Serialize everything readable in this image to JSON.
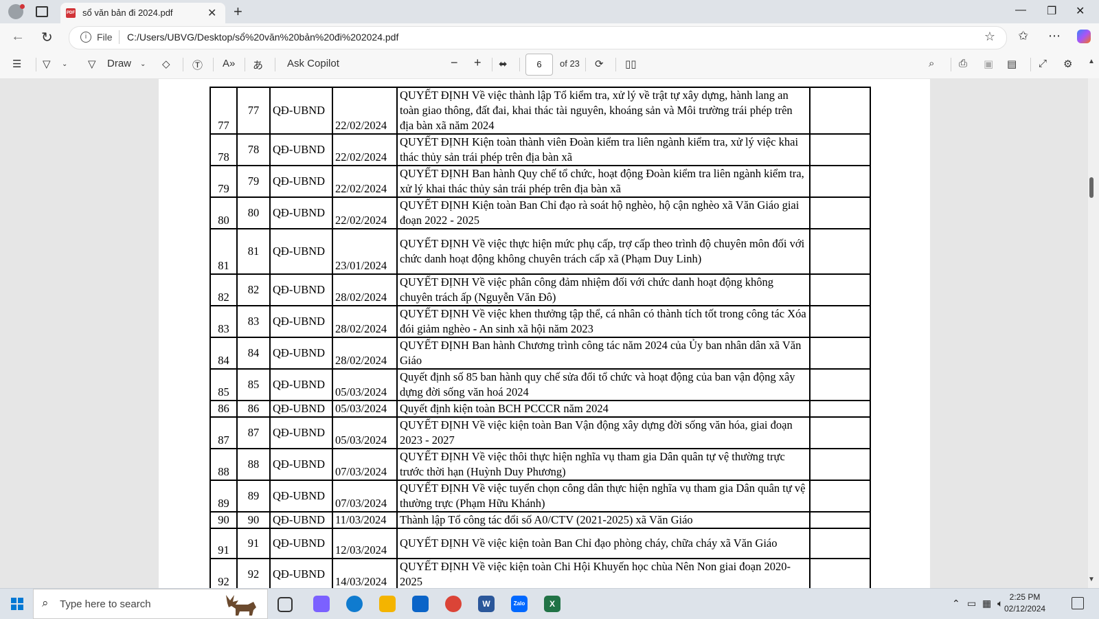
{
  "browser": {
    "tab_title": "sổ văn bản đi 2024.pdf",
    "tab_close": "✕",
    "new_tab": "+",
    "url_prefix": "File",
    "url": "C:/Users/UBVG/Desktop/sổ%20văn%20bản%20đi%202024.pdf",
    "window_controls": [
      "—",
      "❐",
      "✕"
    ]
  },
  "pdf_toolbar": {
    "draw_label": "Draw",
    "ask_copilot_label": "Ask Copilot",
    "page_number": "6",
    "page_total": "of 23",
    "zoom_out": "−",
    "zoom_in": "+"
  },
  "table": {
    "rows": [
      {
        "stt": "77",
        "num": "77",
        "type": "QĐ-UBND",
        "date": "22/02/2024",
        "content": " QUYẾT ĐỊNH Về việc thành lập Tổ kiểm tra, xử lý về trật tự xây dựng, hành lang an toàn giao thông, đất đai, khai thác tài nguyên, khoáng sản và Môi trường trái phép trên địa bàn xã năm 2024"
      },
      {
        "stt": "78",
        "num": "78",
        "type": "QĐ-UBND",
        "date": "22/02/2024",
        "content": "QUYẾT ĐỊNH Kiện toàn thành viên Đoàn kiểm tra liên ngành kiểm tra, xử lý việc khai thác thủy sản trái phép trên địa bàn xã"
      },
      {
        "stt": "79",
        "num": "79",
        "type": "QĐ-UBND",
        "date": "22/02/2024",
        "content": "QUYẾT ĐỊNH Ban hành Quy chế tổ chức, hoạt động Đoàn kiểm tra liên ngành kiểm tra, xử lý khai thác thủy sản trái phép trên địa bàn xã"
      },
      {
        "stt": "80",
        "num": "80",
        "type": "QĐ-UBND",
        "date": "22/02/2024",
        "content": "QUYẾT ĐỊNH Kiện toàn Ban Chỉ đạo rà soát hộ nghèo, hộ cận nghèo xã Văn Giáo giai đoạn 2022 - 2025"
      },
      {
        "stt": "81",
        "num": "81",
        "type": "QĐ-UBND",
        "date": "23/01/2024",
        "content": "QUYẾT ĐỊNH Về việc thực hiện mức phụ cấp, trợ cấp theo trình độ chuyên môn đối với chức danh hoạt động không chuyên trách cấp xã (Phạm Duy Linh)"
      },
      {
        "stt": "82",
        "num": "82",
        "type": "QĐ-UBND",
        "date": "28/02/2024",
        "content": " QUYẾT ĐỊNH Về việc phân công đảm nhiệm đối với chức danh hoạt động không chuyên trách ấp (Nguyễn Văn Đô)"
      },
      {
        "stt": "83",
        "num": "83",
        "type": "QĐ-UBND",
        "date": "28/02/2024",
        "content": "QUYẾT ĐỊNH Về việc khen thưởng tập thể, cá nhân có thành tích tốt trong công tác Xóa đói giảm nghèo - An sinh xã hội năm 2023"
      },
      {
        "stt": "84",
        "num": "84",
        "type": "QĐ-UBND",
        "date": "28/02/2024",
        "content": "QUYẾT ĐỊNH Ban hành Chương trình công tác năm 2024 của Ủy ban nhân dân xã Văn Giáo"
      },
      {
        "stt": "85",
        "num": "85",
        "type": "QĐ-UBND",
        "date": "05/03/2024",
        "content": "Quyết định số 85 ban hành quy chế sửa đổi tổ chức và hoạt động của ban vận động xây dựng đời sống văn hoá 2024"
      },
      {
        "stt": "86",
        "num": "86",
        "type": "QĐ-UBND",
        "date": "05/03/2024",
        "content": "Quyết định kiện toàn BCH PCCCR năm 2024"
      },
      {
        "stt": "87",
        "num": "87",
        "type": "QĐ-UBND",
        "date": "05/03/2024",
        "content": "QUYẾT ĐỊNH Về việc kiện toàn Ban Vận động xây dựng đời sống văn hóa, giai đoạn 2023 - 2027"
      },
      {
        "stt": "88",
        "num": "88",
        "type": "QĐ-UBND",
        "date": "07/03/2024",
        "content": "QUYẾT ĐỊNH Về việc thôi thực hiện nghĩa vụ tham gia Dân quân tự vệ thường trực trước thời hạn (Huỳnh Duy Phương)"
      },
      {
        "stt": "89",
        "num": "89",
        "type": "QĐ-UBND",
        "date": "07/03/2024",
        "content": "QUYẾT ĐỊNH Về việc tuyển chọn công dân thực hiện nghĩa vụ tham gia Dân quân tự vệ thường trực (Phạm Hữu Khánh)"
      },
      {
        "stt": "90",
        "num": "90",
        "type": "QĐ-UBND",
        "date": "11/03/2024",
        "content": "Thành lập Tổ công tác đổi số A0/CTV (2021-2025) xã Văn Giáo"
      },
      {
        "stt": "91",
        "num": "91",
        "type": "QĐ-UBND",
        "date": "12/03/2024",
        "content": "QUYẾT ĐỊNH Về việc kiện toàn Ban Chỉ đạo phòng cháy, chữa cháy xã Văn Giáo"
      },
      {
        "stt": "92",
        "num": "92",
        "type": "QĐ-UBND",
        "date": "14/03/2024",
        "content": "QUYẾT ĐỊNH Về việc kiện toàn Chi Hội Khuyến học chùa Nên Non giai đoạn 2020-2025"
      }
    ]
  },
  "taskbar": {
    "search_placeholder": "Type here to search",
    "time": "2:25 PM",
    "date": "02/12/2024",
    "apps": [
      {
        "name": "task-view-icon",
        "color": "#333333"
      },
      {
        "name": "copilot-app-icon",
        "color": "#7b61ff"
      },
      {
        "name": "edge-icon",
        "color": "#0f7bcf"
      },
      {
        "name": "file-explorer-icon",
        "color": "#f4b400"
      },
      {
        "name": "outlook-icon",
        "color": "#0a64c8"
      },
      {
        "name": "chrome-icon",
        "color": "#db4437"
      },
      {
        "name": "word-icon",
        "color": "#2b579a"
      },
      {
        "name": "zalo-icon",
        "color": "#0068ff"
      },
      {
        "name": "excel-icon",
        "color": "#217346"
      }
    ],
    "word_label": "W",
    "zalo_label": "Zalo",
    "excel_label": "X"
  },
  "colors": {
    "accent": "#0078d4",
    "pdf_icon": "#d13438"
  }
}
